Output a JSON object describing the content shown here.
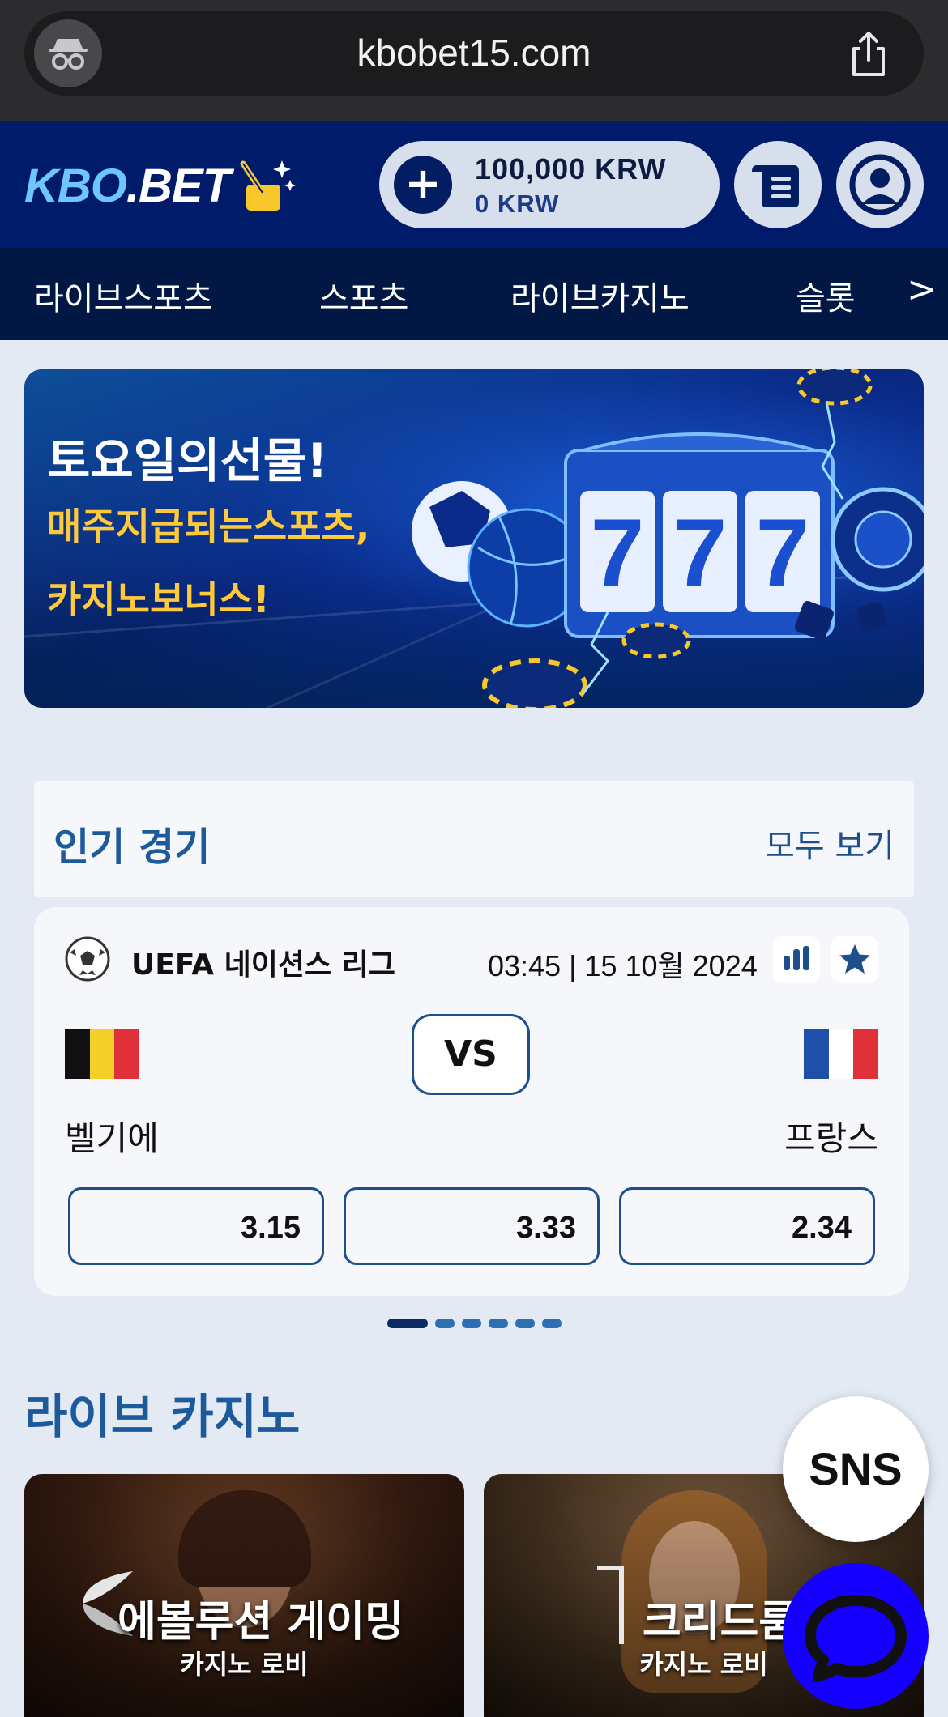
{
  "browser": {
    "url": "kbobet15.com"
  },
  "header": {
    "logo_main": "KBO",
    "logo_dot": ".BET",
    "balance_primary": "100,000 KRW",
    "balance_secondary": "0 KRW"
  },
  "nav": {
    "items": [
      {
        "label": "라이브스포츠"
      },
      {
        "label": "스포츠"
      },
      {
        "label": "라이브카지노"
      },
      {
        "label": "슬롯"
      }
    ],
    "more": ">"
  },
  "banner": {
    "line1": "토요일의선물!",
    "line2": "매주지급되는스포츠,",
    "line3": "카지노보너스!",
    "slot_digits": "777"
  },
  "popular": {
    "title": "인기 경기",
    "view_all": "모두 보기"
  },
  "match": {
    "league": "UEFA 네이션스 리그",
    "datetime": "03:45 | 15 10월 2024",
    "vs": "VS",
    "home": "벨기에",
    "away": "프랑스",
    "odds": [
      "3.15",
      "3.33",
      "2.34"
    ]
  },
  "pagination": {
    "total": 6,
    "active": 0
  },
  "live_casino": {
    "title": "라이브 카지노",
    "cards": [
      {
        "name": "에볼루션 게이밍",
        "sub": "카지노 로비"
      },
      {
        "name": "크리드룸",
        "sub": "카지노 로비"
      }
    ]
  },
  "floating": {
    "sns": "SNS"
  },
  "colors": {
    "header_bg": "#011b6b",
    "nav_bg": "#011845",
    "accent": "#1d5a9c",
    "chat": "#1500ff"
  }
}
